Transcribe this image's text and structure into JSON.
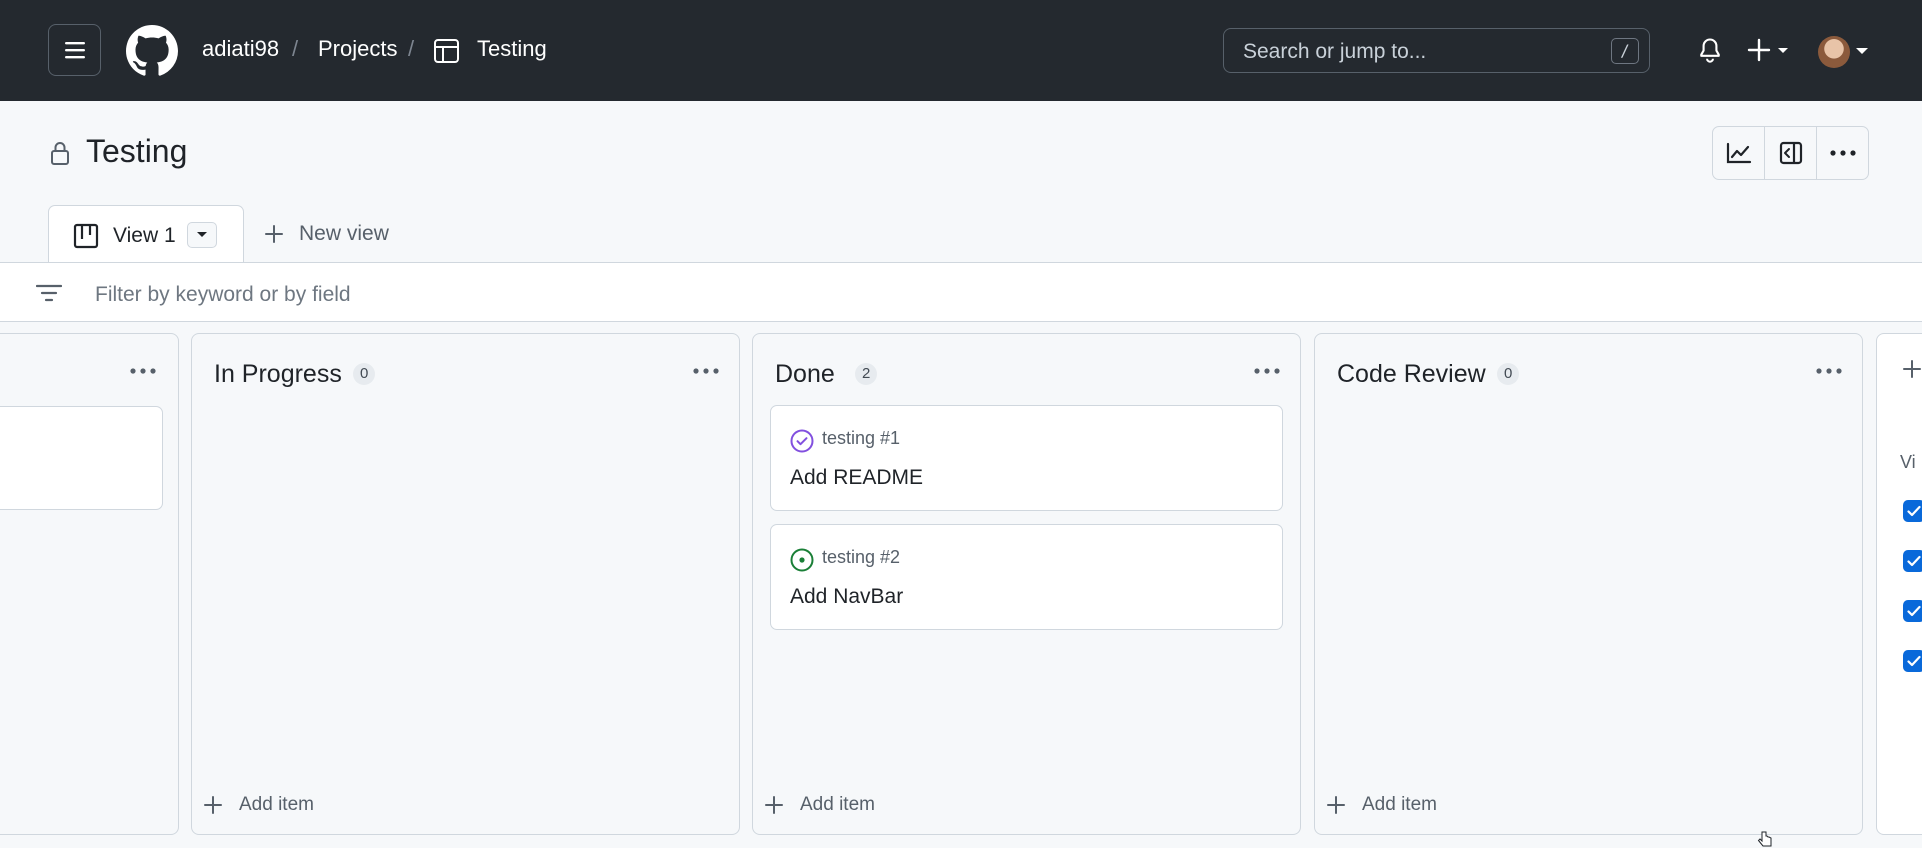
{
  "header": {
    "owner": "adiati98",
    "separator": "/",
    "projects_label": "Projects",
    "project_name": "Testing",
    "search_placeholder": "Search or jump to...",
    "search_shortcut": "/"
  },
  "project": {
    "title": "Testing",
    "actions": [
      "insights-icon",
      "panel-icon",
      "more-icon"
    ]
  },
  "tabs": {
    "active_label": "View 1",
    "new_view_label": "New view"
  },
  "filter": {
    "placeholder": "Filter by keyword or by field"
  },
  "columns": [
    {
      "name": "In Progress",
      "count": "0",
      "add_label": "Add item",
      "cards": []
    },
    {
      "name": "Done",
      "count": "2",
      "add_label": "Add item",
      "cards": [
        {
          "ref": "testing #1",
          "title": "Add README",
          "status": "closed-done",
          "status_color": "#8250df"
        },
        {
          "ref": "testing #2",
          "title": "Add NavBar",
          "status": "open",
          "status_color": "#1a7f37"
        }
      ]
    },
    {
      "name": "Code Review",
      "count": "0",
      "add_label": "Add item",
      "cards": []
    }
  ],
  "side_panel": {
    "label": "Vi"
  },
  "colors": {
    "header_bg": "#24292f",
    "accent": "#0969da",
    "page_bg": "#f6f8fa"
  }
}
